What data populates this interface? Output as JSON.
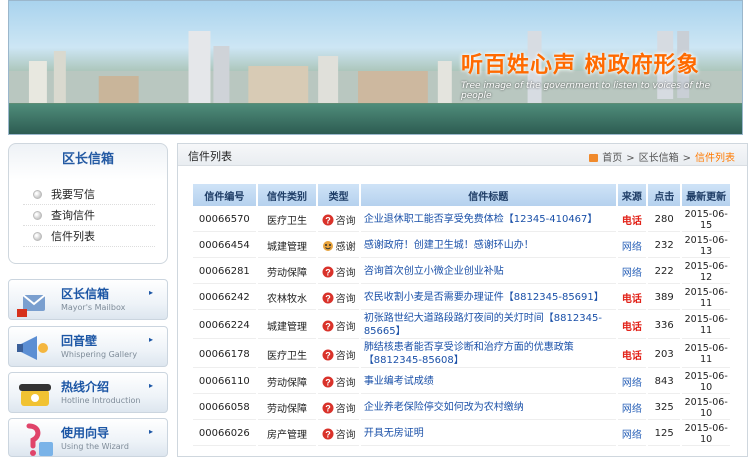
{
  "banner": {
    "slogan": "听百姓心声   树政府形象",
    "slogan_en": "Tree image of the government to listen to voices of the people"
  },
  "sidebar": {
    "title": "区长信箱",
    "items": [
      {
        "label": "我要写信"
      },
      {
        "label": "查询信件"
      },
      {
        "label": "信件列表"
      }
    ],
    "cards": [
      {
        "title": "区长信箱",
        "subtitle": "Mayor's Mailbox",
        "icon": "mailbox-icon"
      },
      {
        "title": "回音壁",
        "subtitle": "Whispering Gallery",
        "icon": "megaphone-icon"
      },
      {
        "title": "热线介绍",
        "subtitle": "Hotline Introduction",
        "icon": "phone-icon"
      },
      {
        "title": "使用向导",
        "subtitle": "Using the Wizard",
        "icon": "guide-icon"
      }
    ]
  },
  "main": {
    "title": "信件列表",
    "breadcrumb": {
      "home": "首页",
      "sep": ">",
      "section": "区长信箱",
      "current": "信件列表"
    },
    "columns": [
      "信件编号",
      "信件类别",
      "类型",
      "信件标题",
      "来源",
      "点击",
      "最新更新"
    ],
    "rows": [
      {
        "id": "00066570",
        "category": "医疗卫生",
        "type": "咨询",
        "subject": "企业退休职工能否享受免费体检【12345-410467】",
        "source": "电话",
        "clicks": "280",
        "date": "2015-06-15"
      },
      {
        "id": "00066454",
        "category": "城建管理",
        "type": "感谢",
        "subject": "感谢政府！创建卫生城！感谢环山办！",
        "source": "网络",
        "clicks": "232",
        "date": "2015-06-13"
      },
      {
        "id": "00066281",
        "category": "劳动保障",
        "type": "咨询",
        "subject": "咨询首次创立小微企业创业补贴",
        "source": "网络",
        "clicks": "222",
        "date": "2015-06-12"
      },
      {
        "id": "00066242",
        "category": "农林牧水",
        "type": "咨询",
        "subject": "农民收割小麦是否需要办理证件【8812345-85691】",
        "source": "电话",
        "clicks": "389",
        "date": "2015-06-11"
      },
      {
        "id": "00066224",
        "category": "城建管理",
        "type": "咨询",
        "subject": "初张路世纪大道路段路灯夜间的关灯时间【8812345-85665】",
        "source": "电话",
        "clicks": "336",
        "date": "2015-06-11"
      },
      {
        "id": "00066178",
        "category": "医疗卫生",
        "type": "咨询",
        "subject": "肺结核患者能否享受诊断和治疗方面的优惠政策【8812345-85608】",
        "source": "电话",
        "clicks": "203",
        "date": "2015-06-11"
      },
      {
        "id": "00066110",
        "category": "劳动保障",
        "type": "咨询",
        "subject": "事业编考试成绩",
        "source": "网络",
        "clicks": "843",
        "date": "2015-06-10"
      },
      {
        "id": "00066058",
        "category": "劳动保障",
        "type": "咨询",
        "subject": "企业养老保险停交如何改为农村缴纳",
        "source": "网络",
        "clicks": "325",
        "date": "2015-06-10"
      },
      {
        "id": "00066026",
        "category": "房产管理",
        "type": "咨询",
        "subject": "开具无房证明",
        "source": "网络",
        "clicks": "125",
        "date": "2015-06-10"
      }
    ]
  },
  "colors": {
    "accent": "#245aa3",
    "phone_source": "#e2231a",
    "web_source": "#2a62b8",
    "breadcrumb_current": "#ff7a00"
  }
}
